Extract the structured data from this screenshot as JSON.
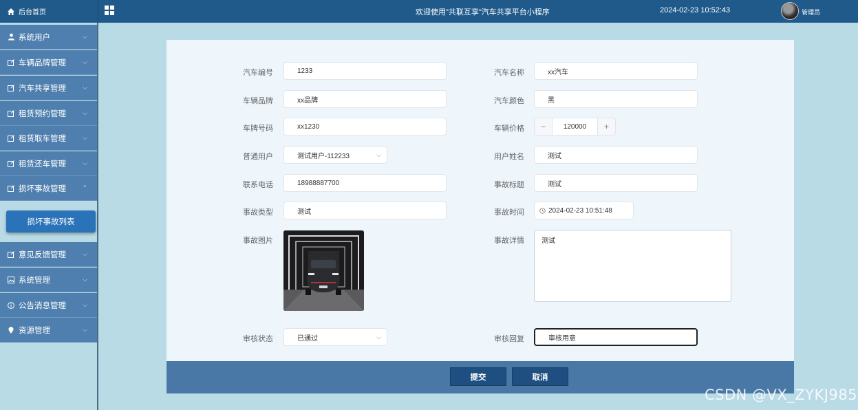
{
  "header": {
    "home_label": "后台首页",
    "welcome": "欢迎使用\"共联互享\"汽车共享平台小程序",
    "datetime": "2024-02-23 10:52:43",
    "user_label": "管理员"
  },
  "sidebar": {
    "items": [
      {
        "label": "系统用户",
        "icon": "user-icon"
      },
      {
        "label": "车辆品牌管理",
        "icon": "edit-icon"
      },
      {
        "label": "汽车共享管理",
        "icon": "edit-icon"
      },
      {
        "label": "租赁预约管理",
        "icon": "edit-icon"
      },
      {
        "label": "租赁取车管理",
        "icon": "edit-icon"
      },
      {
        "label": "租赁还车管理",
        "icon": "edit-icon"
      },
      {
        "label": "损坏事故管理",
        "icon": "edit-icon",
        "expanded": true
      },
      {
        "label": "意见反馈管理",
        "icon": "edit-icon"
      },
      {
        "label": "系统管理",
        "icon": "image-icon"
      },
      {
        "label": "公告消息管理",
        "icon": "info-icon"
      },
      {
        "label": "资源管理",
        "icon": "pin-icon"
      }
    ],
    "active_sub": "损坏事故列表"
  },
  "form": {
    "car_no": {
      "label": "汽车编号",
      "value": "1233"
    },
    "car_name": {
      "label": "汽车名称",
      "value": "xx汽车"
    },
    "brand": {
      "label": "车辆品牌",
      "value": "xx品牌"
    },
    "color": {
      "label": "汽车颜色",
      "value": "黑"
    },
    "plate": {
      "label": "车牌号码",
      "value": "xx1230"
    },
    "price": {
      "label": "车辆价格",
      "value": "120000",
      "minus": "−",
      "plus": "+"
    },
    "user": {
      "label": "普通用户",
      "value": "测试用户-112233"
    },
    "user_name": {
      "label": "用户姓名",
      "value": "测试"
    },
    "phone": {
      "label": "联系电话",
      "value": "18988887700"
    },
    "accident_title": {
      "label": "事故标题",
      "value": "测试"
    },
    "accident_type": {
      "label": "事故类型",
      "value": "测试"
    },
    "accident_time": {
      "label": "事故时间",
      "value": "2024-02-23 10:51:48"
    },
    "accident_image": {
      "label": "事故图片"
    },
    "accident_detail": {
      "label": "事故详情",
      "value": "测试"
    },
    "review_status": {
      "label": "审核状态",
      "value": "已通过"
    },
    "review_reply": {
      "label": "审核回复",
      "value": "审核用意"
    }
  },
  "actions": {
    "submit": "提交",
    "cancel": "取消"
  },
  "watermark": "CSDN @VX_ZYKJ985",
  "colors": {
    "header": "#1f5a8b",
    "menu": "#4f7fae",
    "active_sub": "#2b73b9",
    "footer": "#4a78a6",
    "button": "#1f4f80"
  }
}
